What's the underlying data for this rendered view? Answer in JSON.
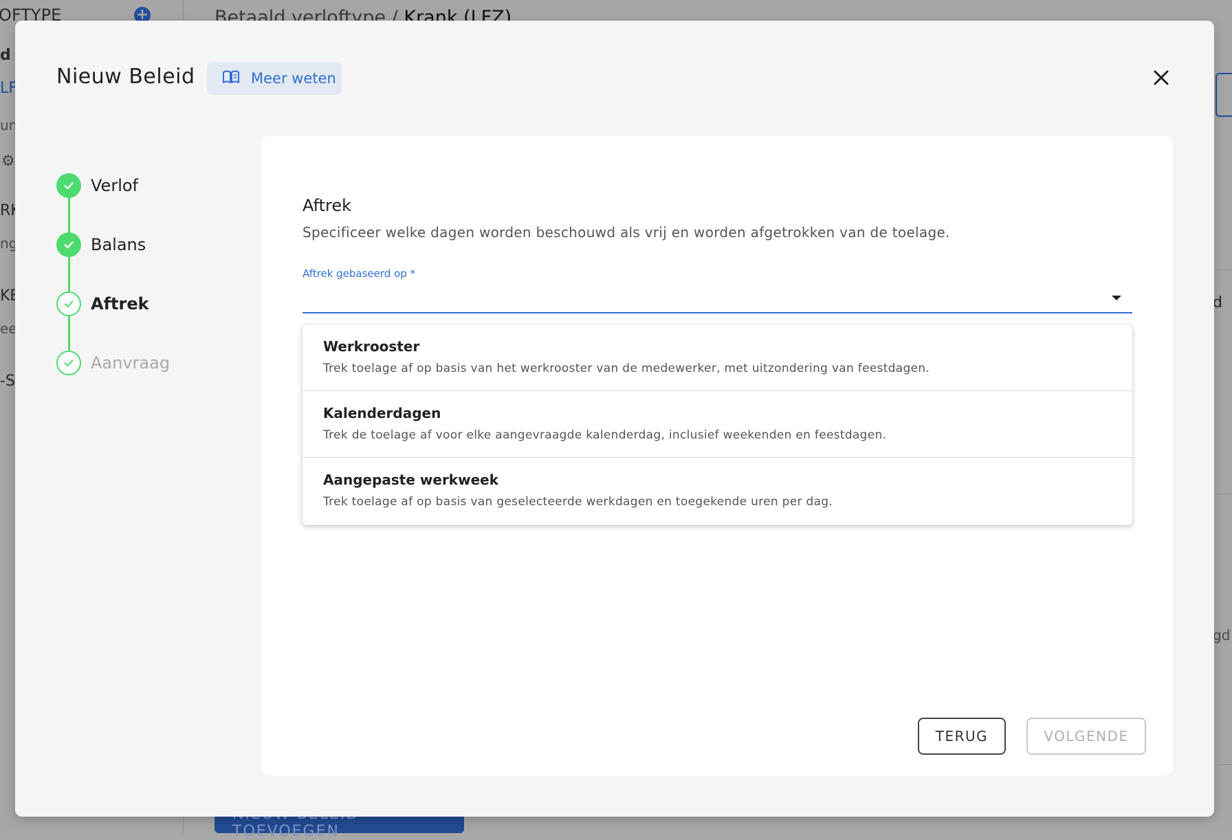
{
  "background": {
    "sidebar_header": "OFTYPE",
    "sidebar_items": [
      "d",
      "LF",
      "un",
      "RK",
      "ng",
      "KE",
      "ee",
      "-S"
    ],
    "breadcrumb_prefix": "Betaald verloftype / ",
    "breadcrumb_current": "Krank (LFZ)",
    "add_policy_button": "NIEUW BELEID TOEVOEGEN",
    "right_fragments": [
      "d",
      "gd"
    ]
  },
  "modal": {
    "title": "Nieuw Beleid",
    "learn_more_label": "Meer weten",
    "close_icon": "close-icon"
  },
  "stepper": {
    "steps": [
      {
        "label": "Verlof",
        "state": "done"
      },
      {
        "label": "Balans",
        "state": "done"
      },
      {
        "label": "Aftrek",
        "state": "active"
      },
      {
        "label": "Aanvraag",
        "state": "upcoming"
      }
    ]
  },
  "content": {
    "section_title": "Aftrek",
    "section_description": "Specificeer welke dagen worden beschouwd als vrij en worden afgetrokken van de toelage.",
    "field_label": "Aftrek gebaseerd op *",
    "field_value": "",
    "options": [
      {
        "title": "Werkrooster",
        "description": "Trek toelage af op basis van het werkrooster van de medewerker, met uitzondering van feestdagen."
      },
      {
        "title": "Kalenderdagen",
        "description": "Trek de toelage af voor elke aangevraagde kalenderdag, inclusief weekenden en feestdagen."
      },
      {
        "title": "Aangepaste werkweek",
        "description": "Trek toelage af op basis van geselecteerde werkdagen en toegekende uren per dag."
      }
    ]
  },
  "buttons": {
    "back_label": "TERUG",
    "next_label": "VOLGENDE",
    "next_enabled": false
  },
  "colors": {
    "accent_blue": "#2f6fd0",
    "step_green": "#4ddb6f",
    "modal_bg": "#f5f5f5",
    "overlay_bg": "#a6a6a6"
  }
}
